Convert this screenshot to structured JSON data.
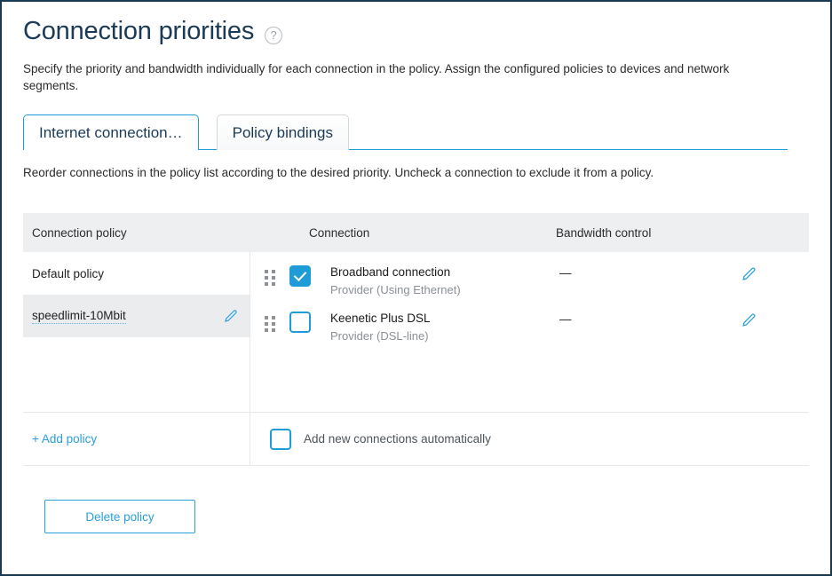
{
  "header": {
    "title": "Connection priorities",
    "help_icon": "question-mark-circle-icon",
    "description": "Specify the priority and bandwidth individually for each connection in the policy. Assign the configured policies to devices and network segments."
  },
  "tabs": [
    {
      "label": "Internet connection…",
      "active": true
    },
    {
      "label": "Policy bindings",
      "active": false
    }
  ],
  "sub_instruction": "Reorder connections in the policy list according to the desired priority. Uncheck a connection to exclude it from a policy.",
  "table": {
    "columns": {
      "policy": "Connection policy",
      "connection": "Connection",
      "bandwidth": "Bandwidth control"
    },
    "policies": [
      {
        "name": "Default policy",
        "selected": false,
        "editable": false
      },
      {
        "name": "speedlimit-10Mbit",
        "selected": true,
        "editable": true,
        "edit_icon": "pencil-icon"
      }
    ],
    "connections": [
      {
        "drag_handle": "drag-dots-icon",
        "checked": true,
        "name": "Broadband connection",
        "subtitle": "Provider (Using Ethernet)",
        "bandwidth": "—",
        "edit_icon": "pencil-icon"
      },
      {
        "drag_handle": "drag-dots-icon",
        "checked": false,
        "name": "Keenetic Plus DSL",
        "subtitle": "Provider (DSL-line)",
        "bandwidth": "—",
        "edit_icon": "pencil-icon"
      }
    ],
    "add_policy_label": "+ Add policy",
    "auto_add": {
      "label": "Add new connections automatically",
      "checked": false
    }
  },
  "footer": {
    "delete_policy_label": "Delete policy"
  },
  "colors": {
    "accent": "#1f9cd8",
    "link": "#2a9fe0",
    "title": "#1b3a57",
    "header_bg": "#eeeff1",
    "selected_row": "#ebecee",
    "border": "#173a52"
  }
}
